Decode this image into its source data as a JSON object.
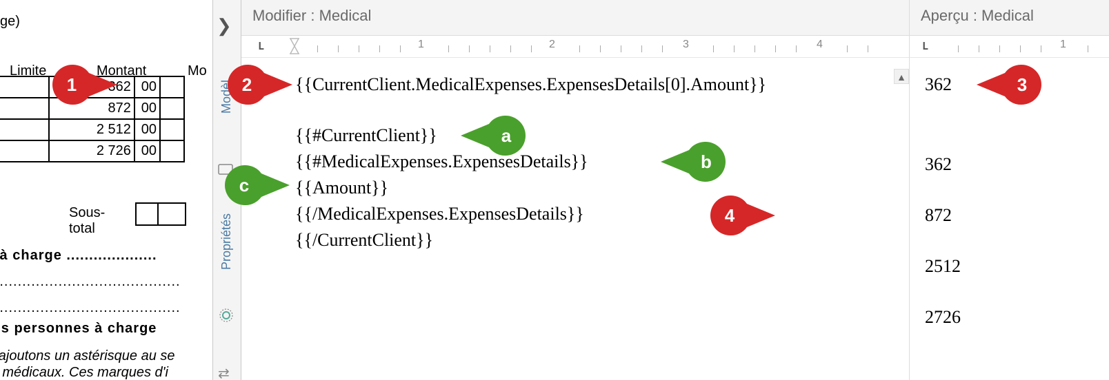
{
  "left": {
    "hdr_age": "ge)",
    "col_limite": "Limite",
    "col_montant": "Montant",
    "col_mo": "Mo",
    "rows": [
      {
        "amount_int": "362",
        "amount_dec": "00"
      },
      {
        "amount_int": "872",
        "amount_dec": "00"
      },
      {
        "amount_int": "2 512",
        "amount_dec": "00"
      },
      {
        "amount_int": "2 726",
        "amount_dec": "00"
      }
    ],
    "subtotal_label": "Sous-total",
    "line_nts": "nts à charge ....................",
    "dots1": "..............................................",
    "dots2": "..............................................",
    "line_other": "utres personnes à charge",
    "footnote1": "ous ajoutons un astérisque au se",
    "footnote2": "frais médicaux. Ces marques d'i"
  },
  "editor": {
    "header": "Modifier : Medical",
    "lines": [
      "{{CurrentClient.MedicalExpenses.ExpensesDetails[0].Amount}}",
      "",
      "{{#CurrentClient}}",
      "{{#MedicalExpenses.ExpensesDetails}}",
      "{{Amount}}",
      "{{/MedicalExpenses.ExpensesDetails}}",
      "{{/CurrentClient}}"
    ]
  },
  "preview": {
    "header": "Aperçu : Medical",
    "values": [
      "362",
      "362",
      "872",
      "2512",
      "2726"
    ]
  },
  "tabs": {
    "models": "Modèl",
    "properties": "Propriétés"
  },
  "ruler": {
    "n1": "1",
    "n2": "2",
    "n3": "3",
    "n4": "4"
  },
  "callouts": {
    "c1": "1",
    "c2": "2",
    "c3": "3",
    "c4": "4",
    "ca": "a",
    "cb": "b",
    "cc": "c"
  }
}
